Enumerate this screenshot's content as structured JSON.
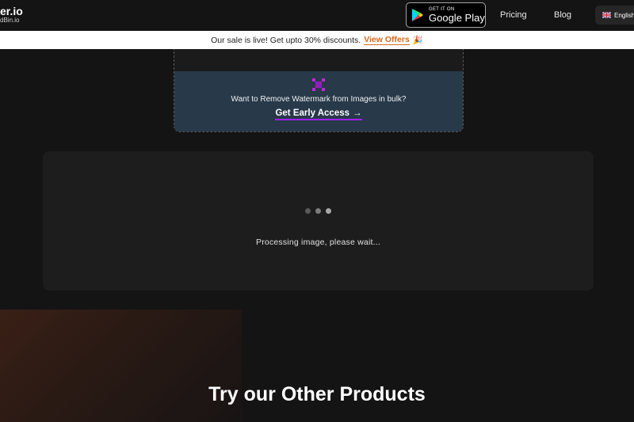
{
  "header": {
    "logo_main": "er.io",
    "logo_sub": "dBin.io",
    "google_play_small": "GET IT ON",
    "google_play_big": "Google Play",
    "nav": {
      "pricing": "Pricing",
      "blog": "Blog"
    },
    "language": "English"
  },
  "banner": {
    "text": "Our sale is live! Get upto 30% discounts.",
    "link": "View Offers",
    "emoji": "🎉"
  },
  "promo": {
    "text": "Want to Remove Watermark from Images in bulk?",
    "cta": "Get Early Access",
    "arrow": "→"
  },
  "processing": {
    "text": "Processing image, please wait..."
  },
  "products": {
    "title": "Try our Other Products"
  },
  "colors": {
    "background": "#141414",
    "accent_orange": "#d9691c",
    "accent_purple": "#a020f0",
    "promo_bg": "#28394a"
  }
}
